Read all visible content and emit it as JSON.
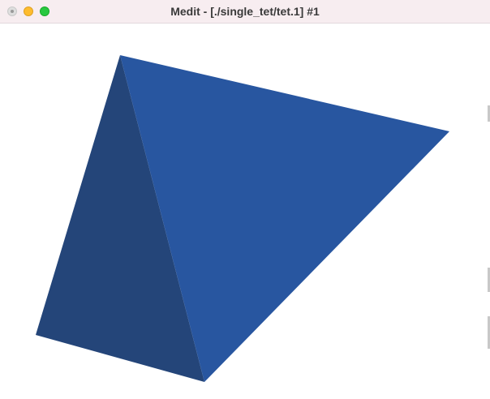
{
  "window": {
    "title": "Medit - [./single_tet/tet.1] #1"
  },
  "traffic_lights": {
    "close_color": "#dedede",
    "minimize_color": "#febc2e",
    "zoom_color": "#28c840"
  },
  "scene": {
    "mesh": "single tetrahedron",
    "background_color": "#ffffff",
    "faces": [
      {
        "name": "front-face",
        "color": "#2856a0"
      },
      {
        "name": "side-face",
        "color": "#244579"
      }
    ]
  }
}
